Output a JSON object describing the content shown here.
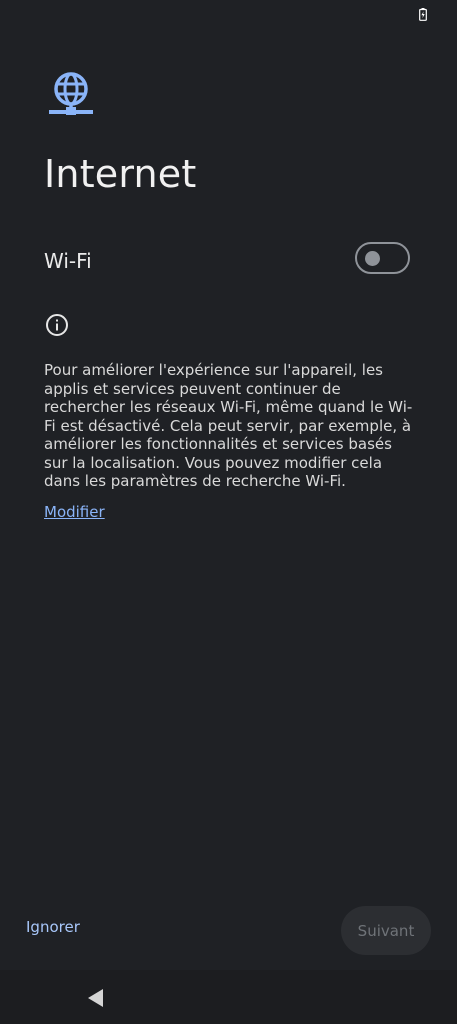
{
  "header": {
    "title": "Internet"
  },
  "wifi": {
    "label": "Wi-Fi",
    "enabled": false
  },
  "info": {
    "text": "Pour améliorer l'expérience sur l'appareil, les applis et services peuvent continuer de rechercher les réseaux Wi-Fi, même quand le Wi-Fi est désactivé. Cela peut servir, par exemple, à améliorer les fonctionnalités et services basés sur la localisation. Vous pouvez modifier cela dans les paramètres de recherche Wi-Fi.",
    "link_label": "Modifier"
  },
  "footer": {
    "skip_label": "Ignorer",
    "next_label": "Suivant"
  },
  "icons": {
    "status": "battery-charging-icon",
    "header": "globe-network-icon",
    "info": "info-icon",
    "nav": "back-triangle-icon"
  },
  "colors": {
    "background": "#1f2125",
    "accent": "#8ab4f8",
    "toggle_off": "#8f9399"
  }
}
